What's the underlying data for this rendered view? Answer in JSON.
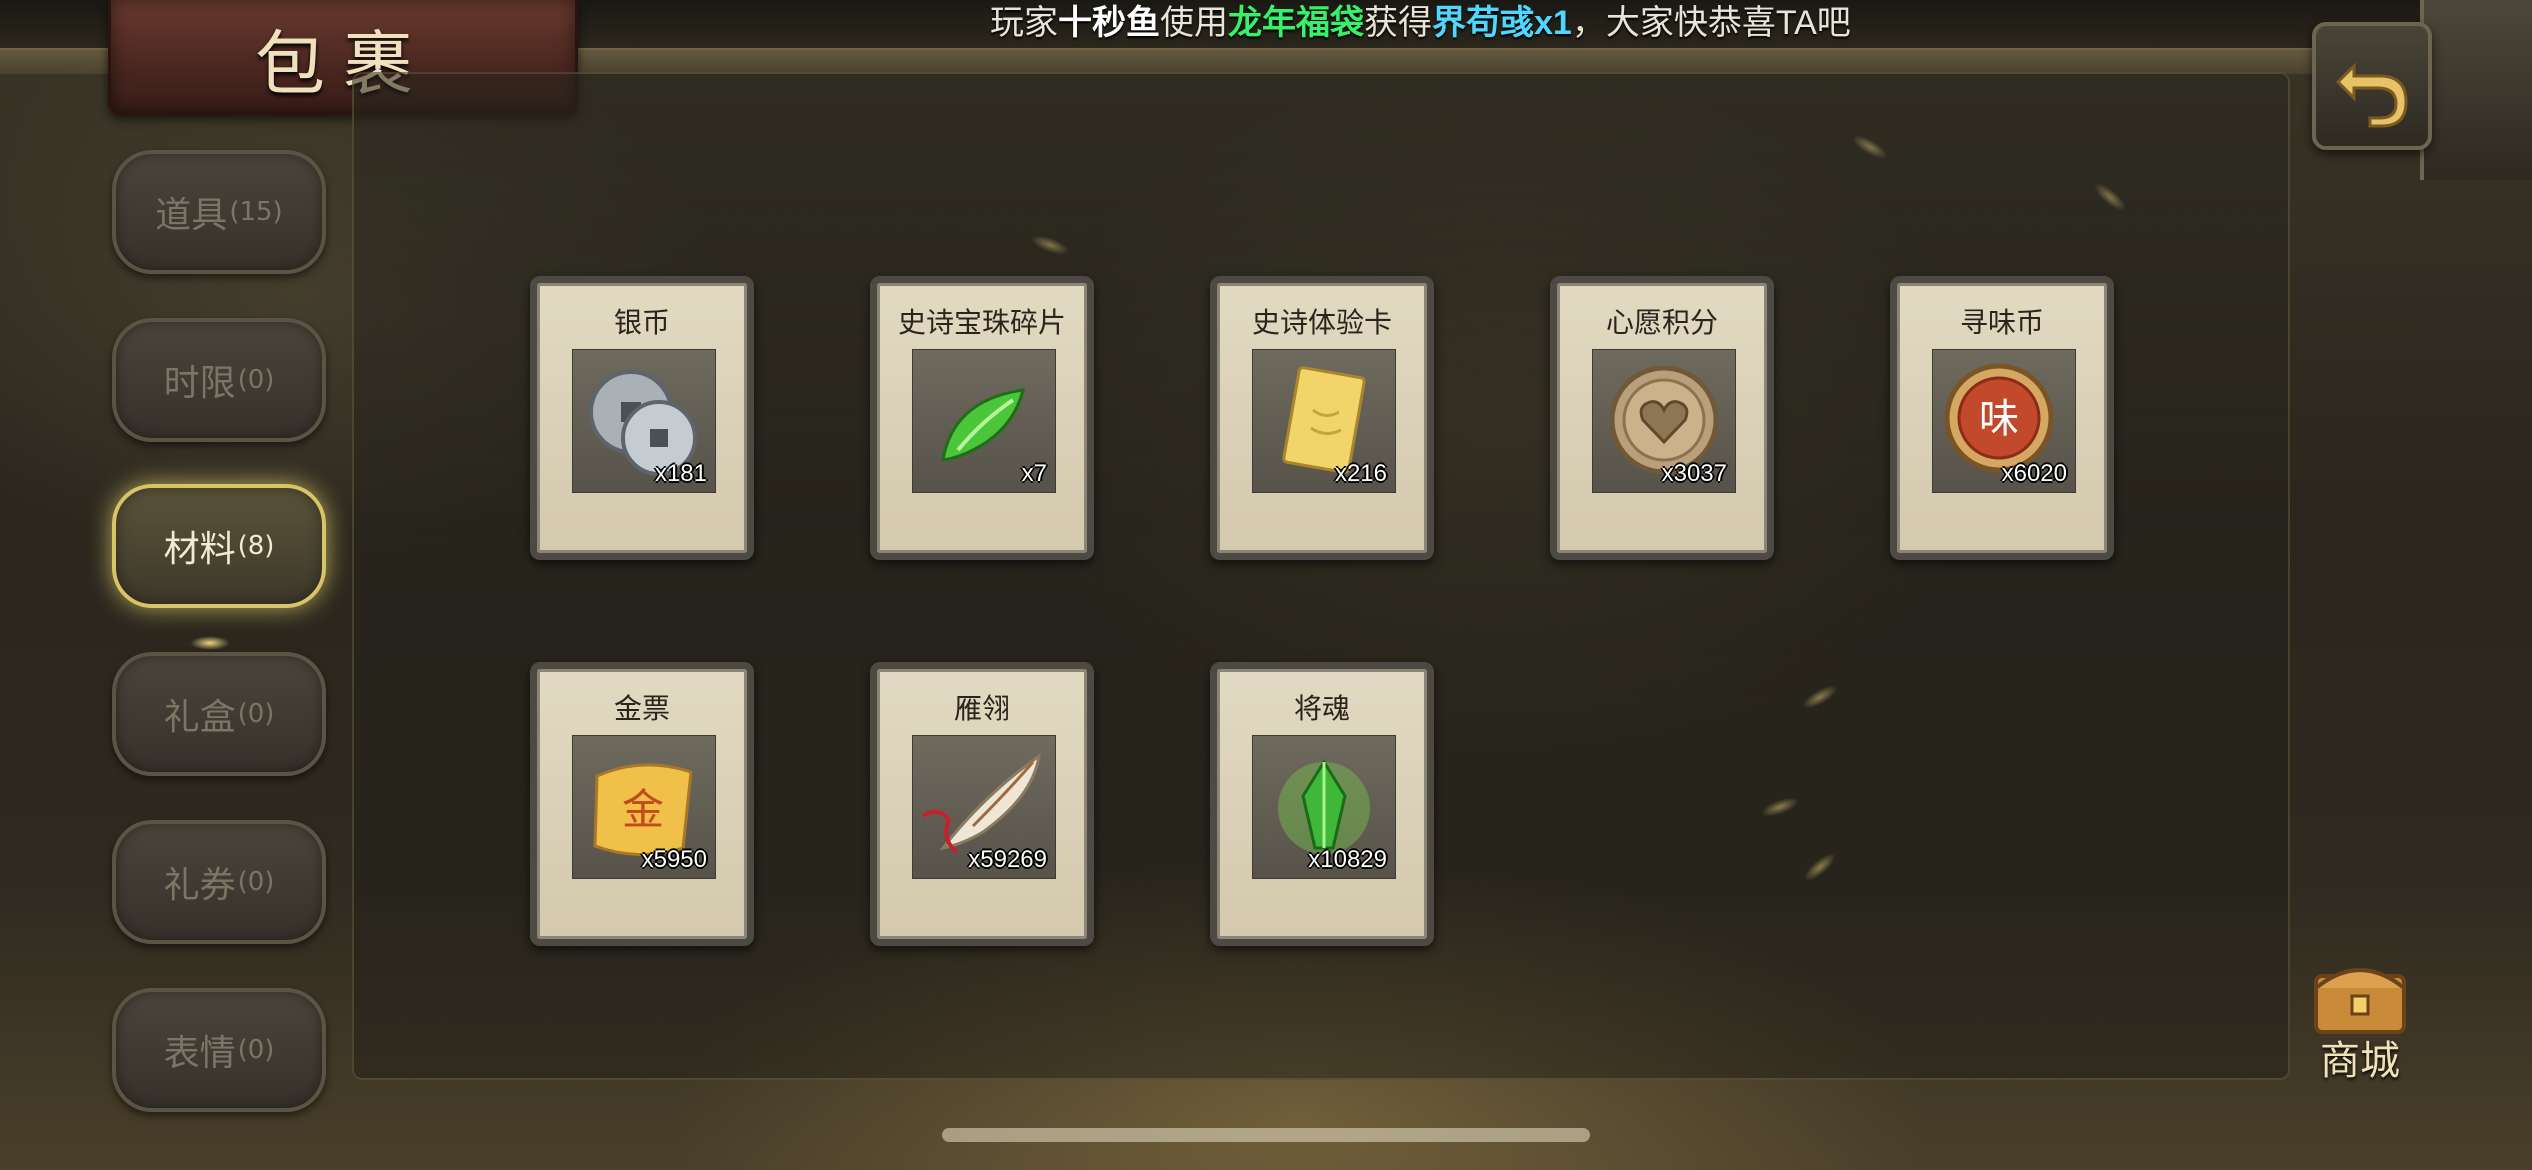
{
  "title": "包裹",
  "marquee": {
    "p1": "玩家",
    "player": "十秒鱼",
    "p2": "使用",
    "item_used": "龙年福袋",
    "p3": "获得",
    "reward": "界苟彧x1",
    "p4": "，大家快恭喜TA吧"
  },
  "tabs": [
    {
      "label": "道具",
      "count": "(15)",
      "active": false
    },
    {
      "label": "时限",
      "count": "(0)",
      "active": false
    },
    {
      "label": "材料",
      "count": "(8)",
      "active": true
    },
    {
      "label": "礼盒",
      "count": "(0)",
      "active": false
    },
    {
      "label": "礼券",
      "count": "(0)",
      "active": false
    },
    {
      "label": "表情",
      "count": "(0)",
      "active": false
    }
  ],
  "items": [
    {
      "name": "银币",
      "qty": "x181",
      "icon": "silver-coin-icon"
    },
    {
      "name": "史诗宝珠碎片",
      "qty": "x7",
      "icon": "green-shard-icon"
    },
    {
      "name": "史诗体验卡",
      "qty": "x216",
      "icon": "gold-card-icon"
    },
    {
      "name": "心愿积分",
      "qty": "x3037",
      "icon": "heart-coin-icon"
    },
    {
      "name": "寻味币",
      "qty": "x6020",
      "icon": "flavor-coin-icon"
    },
    {
      "name": "金票",
      "qty": "x5950",
      "icon": "gold-ticket-icon"
    },
    {
      "name": "雁翎",
      "qty": "x59269",
      "icon": "feather-icon"
    },
    {
      "name": "将魂",
      "qty": "x10829",
      "icon": "green-crystal-icon"
    }
  ],
  "flavor_coin_glyph": "味",
  "gold_ticket_glyph": "金",
  "shop": {
    "label": "商城"
  },
  "colors": {
    "active_tab_glow": "#d8c466",
    "card_bg": "#e2d9c2",
    "highlight_green": "#38f06a",
    "highlight_blue": "#4fd7ff"
  }
}
